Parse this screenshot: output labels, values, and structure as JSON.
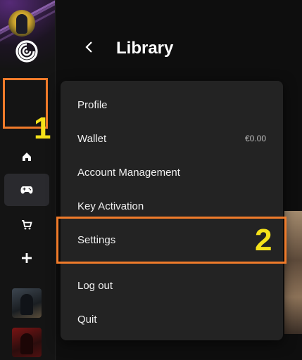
{
  "header": {
    "title": "Library"
  },
  "sidebar": {
    "logo_icon": "ubisoft-swirl-icon",
    "items": [
      {
        "icon": "home-icon"
      },
      {
        "icon": "gamepad-icon",
        "active": true
      },
      {
        "icon": "cart-icon"
      },
      {
        "icon": "plus-icon"
      }
    ],
    "games": [
      {
        "icon": "game-cover-1"
      },
      {
        "icon": "game-cover-2"
      }
    ]
  },
  "menu": {
    "items": [
      {
        "label": "Profile"
      },
      {
        "label": "Wallet",
        "value": "€0.00"
      },
      {
        "label": "Account Management"
      },
      {
        "label": "Key Activation"
      },
      {
        "label": "Settings"
      },
      {
        "label": "Log out"
      },
      {
        "label": "Quit"
      }
    ]
  },
  "annotations": {
    "step1": "1",
    "step2": "2",
    "highlight_color": "#f07b2a",
    "number_color": "#f5e21a"
  }
}
